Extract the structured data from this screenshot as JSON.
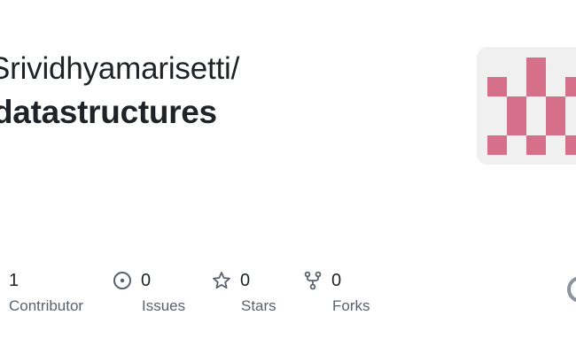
{
  "repo": {
    "owner_path": "Srividhyamarisetti/",
    "name": "datastructures"
  },
  "avatar": {
    "color": "#d6708a",
    "background": "#f0f0f0"
  },
  "stats": {
    "contributors": {
      "value": "1",
      "label": "Contributor"
    },
    "issues": {
      "value": "0",
      "label": "Issues",
      "icon": "issue-icon"
    },
    "stars": {
      "value": "0",
      "label": "Stars",
      "icon": "star-icon"
    },
    "forks": {
      "value": "0",
      "label": "Forks",
      "icon": "fork-icon"
    }
  },
  "colors": {
    "text": "#1f2328",
    "muted": "#59636e",
    "icon": "#59636e"
  }
}
